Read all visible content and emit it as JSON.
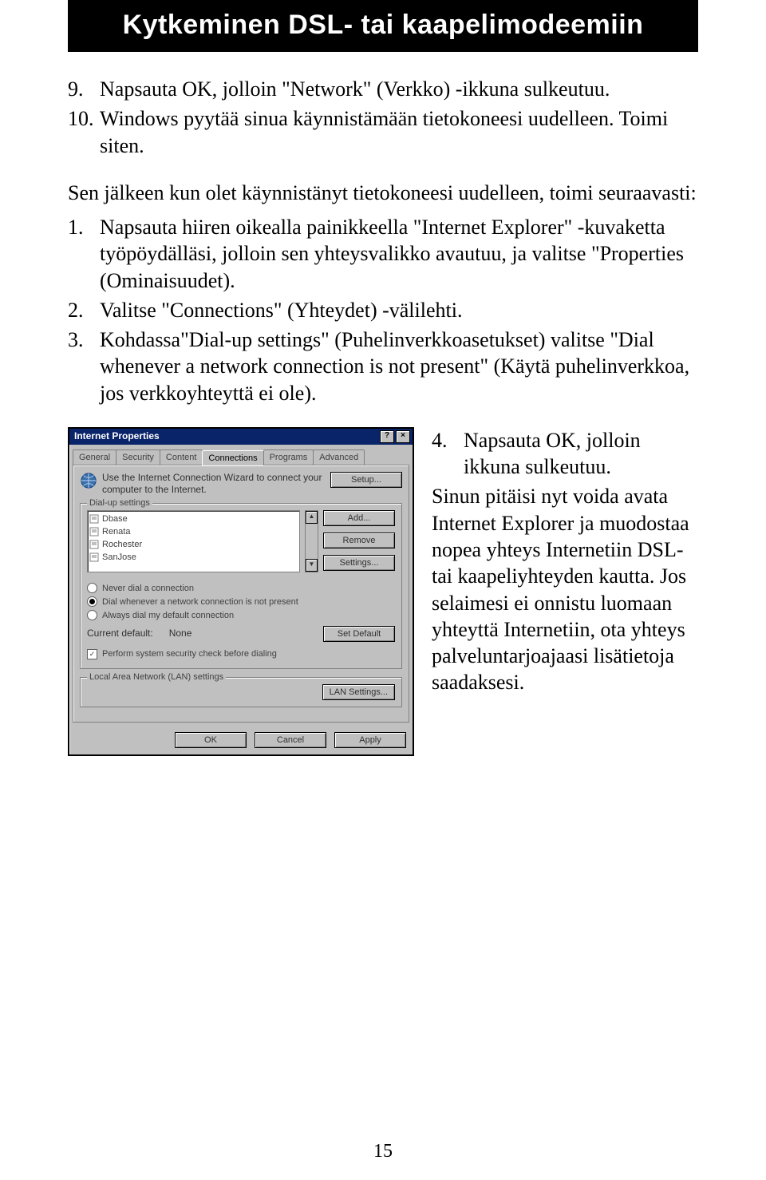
{
  "banner": "Kytkeminen DSL- tai kaapelimodeemiin",
  "list9_num": "9.",
  "list9_text": "Napsauta OK, jolloin \"Network\" (Verkko) -ikkuna sulkeutuu.",
  "list10_num": "10.",
  "list10_text": "Windows pyytää sinua käynnistämään tietokoneesi uudelleen. Toimi siten.",
  "after_text": "Sen jälkeen kun olet käynnistänyt tietokoneesi uudelleen, toimi seuraavasti:",
  "sub1_num": "1.",
  "sub1_text": "Napsauta hiiren oikealla painikkeella \"Internet Explorer\" -kuvaketta työpöydälläsi, jolloin sen yhteysvalikko avautuu, ja valitse \"Properties (Ominaisuudet).",
  "sub2_num": "2.",
  "sub2_text": "Valitse \"Connections\" (Yhteydet) -välilehti.",
  "sub3_num": "3.",
  "sub3_text": "Kohdassa\"Dial-up settings\" (Puhelinverkkoasetukset) valitse \"Dial whenever a network connection is not present\" (Käytä puhelinverkkoa, jos verkkoyhteyttä ei ole).",
  "right_num": "4.",
  "right_text_a": "Napsauta OK, jolloin ikkuna sulkeutuu.",
  "right_para": "Sinun pitäisi nyt voida avata Internet Explorer ja muodostaa nopea yhteys Internetiin DSL- tai kaapeliyhteyden kautta. Jos selaimesi ei onnistu luomaan yhteyttä Internetiin, ota yhteys palveluntarjoajaasi lisätietoja saadaksesi.",
  "page_num": "15",
  "dlg": {
    "title": "Internet Properties",
    "qm": "?",
    "cl": "×",
    "tabs": [
      "General",
      "Security",
      "Content",
      "Connections",
      "Programs",
      "Advanced"
    ],
    "wizard": "Use the Internet Connection Wizard to connect your computer to the Internet.",
    "setup": "Setup...",
    "dialup_label": "Dial-up settings",
    "items": [
      "Dbase",
      "Renata",
      "Rochester",
      "SanJose"
    ],
    "add": "Add...",
    "remove": "Remove",
    "settings": "Settings...",
    "r1": "Never dial a connection",
    "r2": "Dial whenever a network connection is not present",
    "r3": "Always dial my default connection",
    "cur_def_lbl": "Current default:",
    "cur_def_val": "None",
    "setdef": "Set Default",
    "chk": "Perform system security check before dialing",
    "lan_label": "Local Area Network (LAN) settings",
    "lan_btn": "LAN Settings...",
    "ok": "OK",
    "cancel": "Cancel",
    "apply": "Apply"
  }
}
